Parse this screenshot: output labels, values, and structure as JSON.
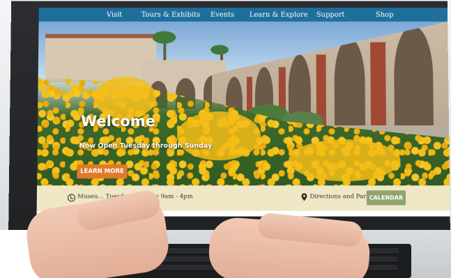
{
  "nav": {
    "items": [
      "Visit",
      "Tours & Exhibits",
      "Events",
      "Learn & Explore",
      "Support",
      "Shop"
    ]
  },
  "hero": {
    "title": "Welcome",
    "subtitle": "Now Open Tuesday through Sunday",
    "cta_label": "LEARN MORE"
  },
  "info_bar": {
    "hours_text": "Museu… Tuesday - Sunday 9am - 4pm",
    "directions_label": "Directions and Parking",
    "calendar_label": "CALENDAR"
  },
  "icons": {
    "clock": "clock-icon",
    "pin": "map-pin-icon"
  },
  "colors": {
    "nav_bg": "#1f6f9c",
    "cta_bg": "#e07a2a",
    "info_bar_bg": "#efe7c6",
    "calendar_bg": "#8fa56e"
  }
}
